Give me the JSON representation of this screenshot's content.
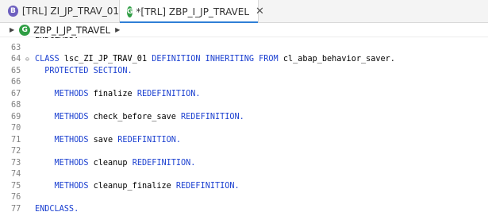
{
  "tabs": [
    {
      "label": "[TRL] ZI_JP_TRAV_01",
      "icon": "class-icon",
      "active": false
    },
    {
      "label": "*[TRL] ZBP_I_JP_TRAVEL",
      "icon": "implementation-icon",
      "active": true
    }
  ],
  "breadcrumb": {
    "label": "ZBP_I_JP_TRAVEL"
  },
  "colors": {
    "keyword": "#1a3fd0",
    "line_number": "#808080",
    "active_tab_underline": "#2f7fd6"
  },
  "editor": {
    "lines": [
      {
        "n": "",
        "tokens": [
          {
            "t": "ENDCLASS.",
            "k": false
          }
        ],
        "clip": true
      },
      {
        "n": "63",
        "tokens": []
      },
      {
        "n": "64",
        "fold": true,
        "tokens": [
          {
            "t": "CLASS",
            "k": true
          },
          {
            "t": " lsc_ZI_JP_TRAV_01 ",
            "k": false
          },
          {
            "t": "DEFINITION INHERITING FROM",
            "k": true
          },
          {
            "t": " cl_abap_behavior_saver.",
            "k": false
          }
        ]
      },
      {
        "n": "65",
        "tokens": [
          {
            "t": "  ",
            "k": false
          },
          {
            "t": "PROTECTED SECTION.",
            "k": true
          }
        ]
      },
      {
        "n": "66",
        "tokens": []
      },
      {
        "n": "67",
        "tokens": [
          {
            "t": "    ",
            "k": false
          },
          {
            "t": "METHODS",
            "k": true
          },
          {
            "t": " finalize ",
            "k": false
          },
          {
            "t": "REDEFINITION.",
            "k": true
          }
        ]
      },
      {
        "n": "68",
        "tokens": []
      },
      {
        "n": "69",
        "tokens": [
          {
            "t": "    ",
            "k": false
          },
          {
            "t": "METHODS",
            "k": true
          },
          {
            "t": " check_before_save ",
            "k": false
          },
          {
            "t": "REDEFINITION.",
            "k": true
          }
        ]
      },
      {
        "n": "70",
        "tokens": []
      },
      {
        "n": "71",
        "tokens": [
          {
            "t": "    ",
            "k": false
          },
          {
            "t": "METHODS",
            "k": true
          },
          {
            "t": " save ",
            "k": false
          },
          {
            "t": "REDEFINITION.",
            "k": true
          }
        ]
      },
      {
        "n": "72",
        "tokens": []
      },
      {
        "n": "73",
        "tokens": [
          {
            "t": "    ",
            "k": false
          },
          {
            "t": "METHODS",
            "k": true
          },
          {
            "t": " cleanup ",
            "k": false
          },
          {
            "t": "REDEFINITION.",
            "k": true
          }
        ]
      },
      {
        "n": "74",
        "tokens": []
      },
      {
        "n": "75",
        "tokens": [
          {
            "t": "    ",
            "k": false
          },
          {
            "t": "METHODS",
            "k": true
          },
          {
            "t": " cleanup_finalize ",
            "k": false
          },
          {
            "t": "REDEFINITION.",
            "k": true
          }
        ]
      },
      {
        "n": "76",
        "tokens": []
      },
      {
        "n": "77",
        "tokens": [
          {
            "t": "ENDCLASS.",
            "k": true
          }
        ]
      }
    ]
  }
}
